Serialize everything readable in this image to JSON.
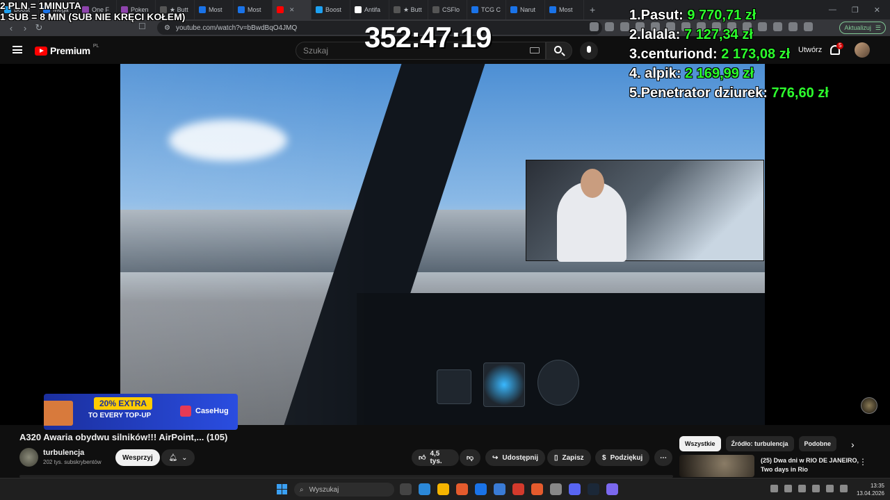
{
  "overlay": {
    "rate_line_1": "2 PLN =  1MINUTA",
    "rate_line_2": "1 SUB = 8 MIN (SUB NIE KRĘCI KOŁEM)",
    "timer": "352:47:19",
    "leaderboard": [
      {
        "name": "1.Pasut:",
        "amount": "9 770,71 zł"
      },
      {
        "name": "2.lalala:",
        "amount": "7 127,34 zł"
      },
      {
        "name": "3.centuriond:",
        "amount": "2 173,08 zł"
      },
      {
        "name": "4. alpik:",
        "amount": "2 169,99 zł"
      },
      {
        "name": "5.Penetrator dziurek:",
        "amount": "776,60 zł"
      }
    ]
  },
  "browser": {
    "tabs": [
      {
        "label": "Boost",
        "color": "#1da1f2"
      },
      {
        "label": "Mega",
        "color": "#1a73e8"
      },
      {
        "label": "One F",
        "color": "#8e44ad"
      },
      {
        "label": "Poken",
        "color": "#8e44ad"
      },
      {
        "label": "★ Butt",
        "color": "#555555"
      },
      {
        "label": "Most",
        "color": "#1a73e8"
      },
      {
        "label": "Most",
        "color": "#1a73e8"
      },
      {
        "label": "",
        "color": "#ff0000",
        "active": true
      },
      {
        "label": "Boost",
        "color": "#1da1f2"
      },
      {
        "label": "Antifa",
        "color": "#ffffff"
      },
      {
        "label": "★ Butt",
        "color": "#555555"
      },
      {
        "label": "CSFlo",
        "color": "#555555"
      },
      {
        "label": "TCG C",
        "color": "#1a73e8"
      },
      {
        "label": "Narut",
        "color": "#1a73e8"
      },
      {
        "label": "Most",
        "color": "#1a73e8"
      }
    ],
    "url": "youtube.com/watch?v=bBwdBqO4JMQ",
    "update_label": "Aktualizuj"
  },
  "youtube": {
    "brand": "Premium",
    "region": "PL",
    "search_placeholder": "Szukaj",
    "create_label": "Utwórz",
    "notification_count": "5"
  },
  "ad": {
    "headline": "20% EXTRA",
    "subline": "TO EVERY TOP-UP",
    "brand": "CaseHug"
  },
  "video": {
    "title": "A320 Awaria obydwu silników!!! AirPoint,... (105)",
    "channel": "turbulencja",
    "subscribers": "202 tys. subskrybentów",
    "support_label": "Wesprzyj",
    "likes": "4,5 tys.",
    "share_label": "Udostępnij",
    "save_label": "Zapisz",
    "thanks_label": "Podziękuj"
  },
  "sidebar": {
    "chips": [
      "Wszystkie",
      "Źródło: turbulencja",
      "Podobne"
    ],
    "recommendation_title": "(25) Dwa dni w RIO DE JANEIRO, Two days in Rio"
  },
  "taskbar": {
    "search_placeholder": "Wyszukaj",
    "time": "13:35",
    "date": "13.04.2026",
    "app_colors": [
      "#444444",
      "#2b88d8",
      "#f5b400",
      "#e55b2d",
      "#1a73e8",
      "#3a7bd5",
      "#d33a2c",
      "#e55b2d",
      "#888888",
      "#5865f2",
      "#1b2838",
      "#7b68ee"
    ]
  }
}
